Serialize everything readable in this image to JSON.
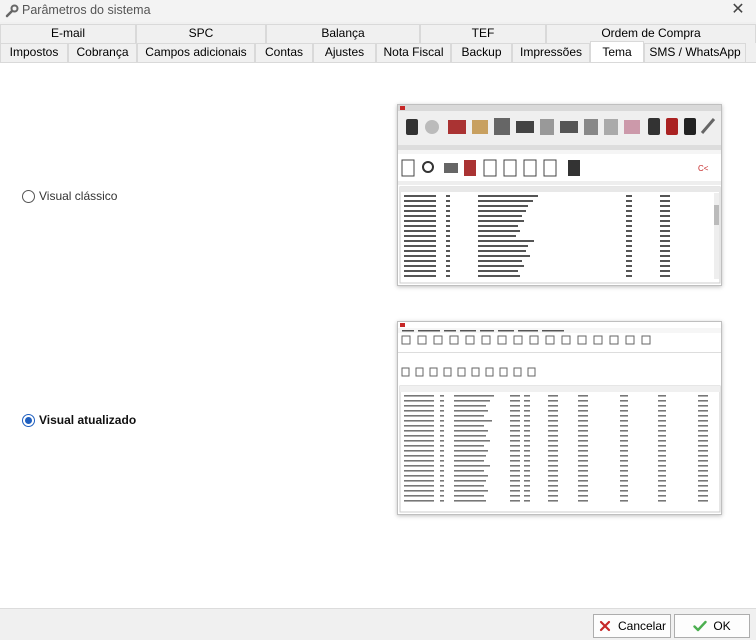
{
  "window": {
    "title": "Parâmetros do sistema",
    "icon": "wrench-icon",
    "close_icon": "close-icon"
  },
  "tabs_row1": [
    "E-mail",
    "SPC",
    "Balança",
    "TEF",
    "Ordem de Compra"
  ],
  "tabs_row2": [
    "Impostos",
    "Cobrança",
    "Campos adicionais",
    "Contas",
    "Ajustes",
    "Nota Fiscal",
    "Backup",
    "Impressões",
    "Tema",
    "SMS / WhatsApp"
  ],
  "active_tab": "Tema",
  "theme": {
    "classic_label": "Visual clássico",
    "updated_label": "Visual atualizado",
    "selected": "updated"
  },
  "buttons": {
    "cancel": "Cancelar",
    "ok": "OK"
  },
  "colors": {
    "accent": "#1f5fbf",
    "cancel_icon": "#c62828",
    "ok_icon": "#4caf50"
  }
}
